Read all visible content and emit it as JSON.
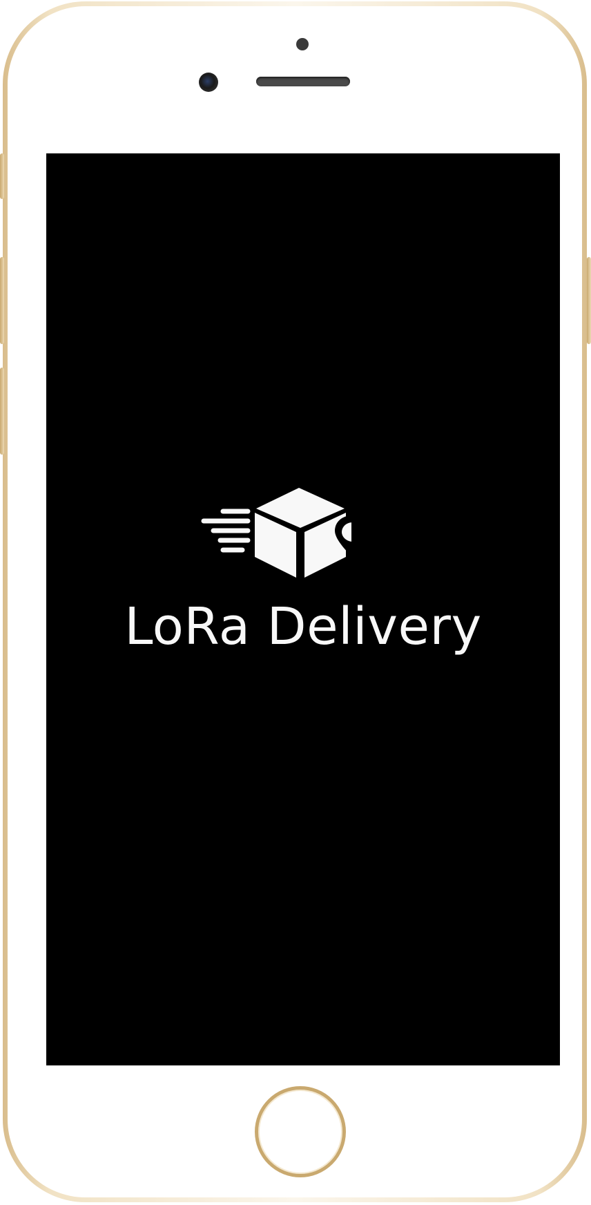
{
  "app": {
    "name": "LoRa Delivery",
    "logo_icon": "delivery-box-pin-icon",
    "screen_background": "#000000",
    "foreground_color": "#f8f8f8"
  },
  "device": {
    "frame_color": "#e8d4ae",
    "face_color": "#ffffff"
  }
}
